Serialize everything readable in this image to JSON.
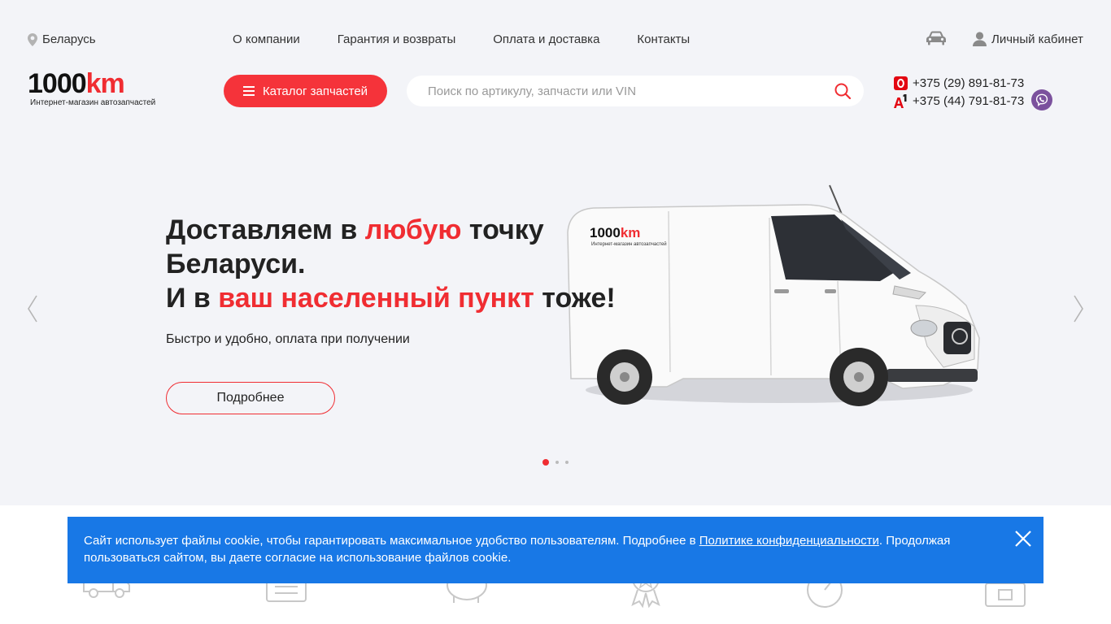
{
  "topbar": {
    "region": "Беларусь",
    "nav": [
      "О компании",
      "Гарантия и возвраты",
      "Оплата и доставка",
      "Контакты"
    ],
    "cabinet": "Личный кабинет"
  },
  "header": {
    "logo_main": "1000",
    "logo_accent": "km",
    "logo_sub": "Интернет-магазин автозапчастей",
    "catalog_label": "Каталог запчастей",
    "search_placeholder": "Поиск по артикулу, запчасти или VIN",
    "phone1": "+375 (29) 891-81-73",
    "phone2": "+375 (44) 791-81-73"
  },
  "hero": {
    "line1_a": "Доставляем в ",
    "line1_red": "любую",
    "line1_b": " точку",
    "line2": "Беларуси.",
    "line3_a": "И в ",
    "line3_red": "ваш населенный пункт",
    "line3_b": " тоже!",
    "subtitle": "Быстро и удобно, оплата при получении",
    "button": "Подробнее",
    "van_logo_main": "1000",
    "van_logo_accent": "km",
    "van_logo_sub": "Интернет-магазин автозапчастей",
    "active_slide": 1,
    "slides": 3
  },
  "cookie": {
    "text1": "Сайт использует файлы cookie, чтобы гарантировать максимальное удобство пользователям. Подробнее в ",
    "link": "Политике конфиденциальности",
    "text2": ". Продолжая пользоваться сайтом, вы даете согласие на использование файлов cookie."
  },
  "colors": {
    "accent": "#f02d32",
    "cookie_bg": "#1878e6",
    "page_bg": "#f3f4f8",
    "viber": "#7b519d"
  }
}
